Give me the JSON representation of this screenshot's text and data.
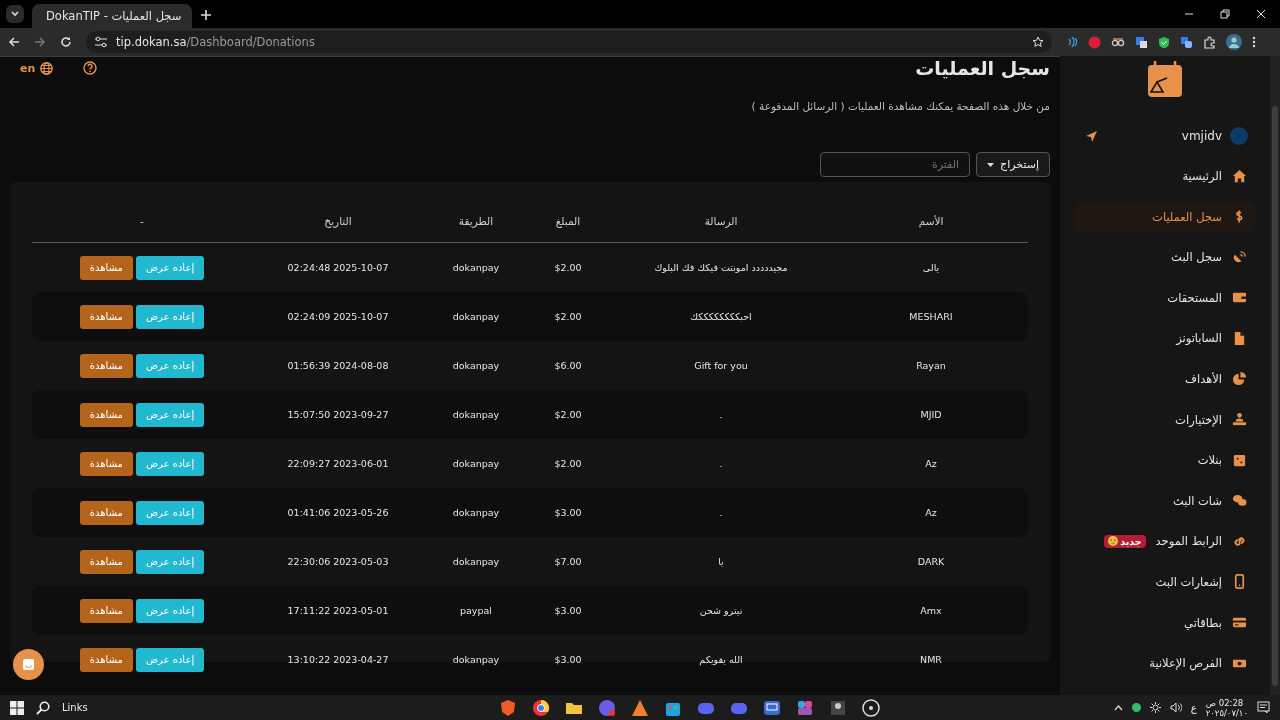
{
  "browser": {
    "tab_title": "DokanTIP - سجل العمليات",
    "url_host": "tip.dokan.sa",
    "url_path": "/Dashboard/Donations"
  },
  "header": {
    "language": "en",
    "title": "سجل العمليات",
    "subtitle": "من خلال هذه الصفحة يمكنك مشاهدة العمليات ( الرسائل المدفوعة )"
  },
  "toolbar": {
    "export_label": "إستخراج",
    "range_placeholder": "الفترة"
  },
  "table": {
    "columns": [
      "الأسم",
      "الرسالة",
      "المبلغ",
      "الطريقة",
      "التاريخ",
      "-"
    ],
    "rows": [
      {
        "name": "يالى",
        "message": "مجيددددد امونتت فيكك فك البلوك",
        "amount": "$2.00",
        "method": "dokanpay",
        "date": "02:24:48 2025-10-07",
        "actions": [
          "إعاده عرض",
          "مشاهدة"
        ]
      },
      {
        "name": "MESHARI",
        "message": "احبككككككككك",
        "amount": "$2.00",
        "method": "dokanpay",
        "date": "02:24:09 2025-10-07",
        "actions": [
          "إعاده عرض",
          "مشاهدة"
        ]
      },
      {
        "name": "Rayan",
        "message": "Gift for you",
        "amount": "$6.00",
        "method": "dokanpay",
        "date": "01:56:39 2024-08-08",
        "actions": [
          "إعاده عرض",
          "مشاهدة"
        ]
      },
      {
        "name": "MJID",
        "message": ".",
        "amount": "$2.00",
        "method": "dokanpay",
        "date": "15:07:50 2023-09-27",
        "actions": [
          "إعاده عرض",
          "مشاهدة"
        ]
      },
      {
        "name": "Az",
        "message": ".",
        "amount": "$2.00",
        "method": "dokanpay",
        "date": "22:09:27 2023-06-01",
        "actions": [
          "إعاده عرض",
          "مشاهدة"
        ]
      },
      {
        "name": "Az",
        "message": ".",
        "amount": "$3.00",
        "method": "dokanpay",
        "date": "01:41:06 2023-05-26",
        "actions": [
          "إعاده عرض",
          "مشاهدة"
        ]
      },
      {
        "name": "DARK",
        "message": "يا",
        "amount": "$7.00",
        "method": "dokanpay",
        "date": "22:30:06 2023-05-03",
        "actions": [
          "إعاده عرض",
          "مشاهدة"
        ]
      },
      {
        "name": "Amx",
        "message": "نيترو شحن",
        "amount": "$3.00",
        "method": "paypal",
        "date": "17:11:22 2023-05-01",
        "actions": [
          "إعاده عرض",
          "مشاهدة"
        ]
      },
      {
        "name": "NMR",
        "message": "الله يقويكم",
        "amount": "$3.00",
        "method": "dokanpay",
        "date": "13:10:22 2023-04-27",
        "actions": [
          "إعاده عرض",
          "مشاهدة"
        ]
      }
    ]
  },
  "sidebar": {
    "user": "vmjidv",
    "items": [
      {
        "label": "الرئيسية",
        "selected": false
      },
      {
        "label": "سجل العمليات",
        "selected": true
      },
      {
        "label": "سجل البث",
        "selected": false
      },
      {
        "label": "المستحقات",
        "selected": false
      },
      {
        "label": "الساباتونز",
        "selected": false
      },
      {
        "label": "الأهداف",
        "selected": false
      },
      {
        "label": "الإختيارات",
        "selected": false
      },
      {
        "label": "بنلات",
        "selected": false
      },
      {
        "label": "شات البث",
        "selected": false
      },
      {
        "label": "الرابط الموحد",
        "selected": false,
        "badge": "جديد"
      },
      {
        "label": "إشعارات البث",
        "selected": false
      },
      {
        "label": "بطاقاتي",
        "selected": false
      },
      {
        "label": "الفرص الإعلانية",
        "selected": false
      }
    ]
  },
  "taskbar": {
    "search_label": "Links",
    "input_language": "ع",
    "time": "02:28 ص",
    "date": "٢٠٢٥/٠٧/١٠"
  }
}
